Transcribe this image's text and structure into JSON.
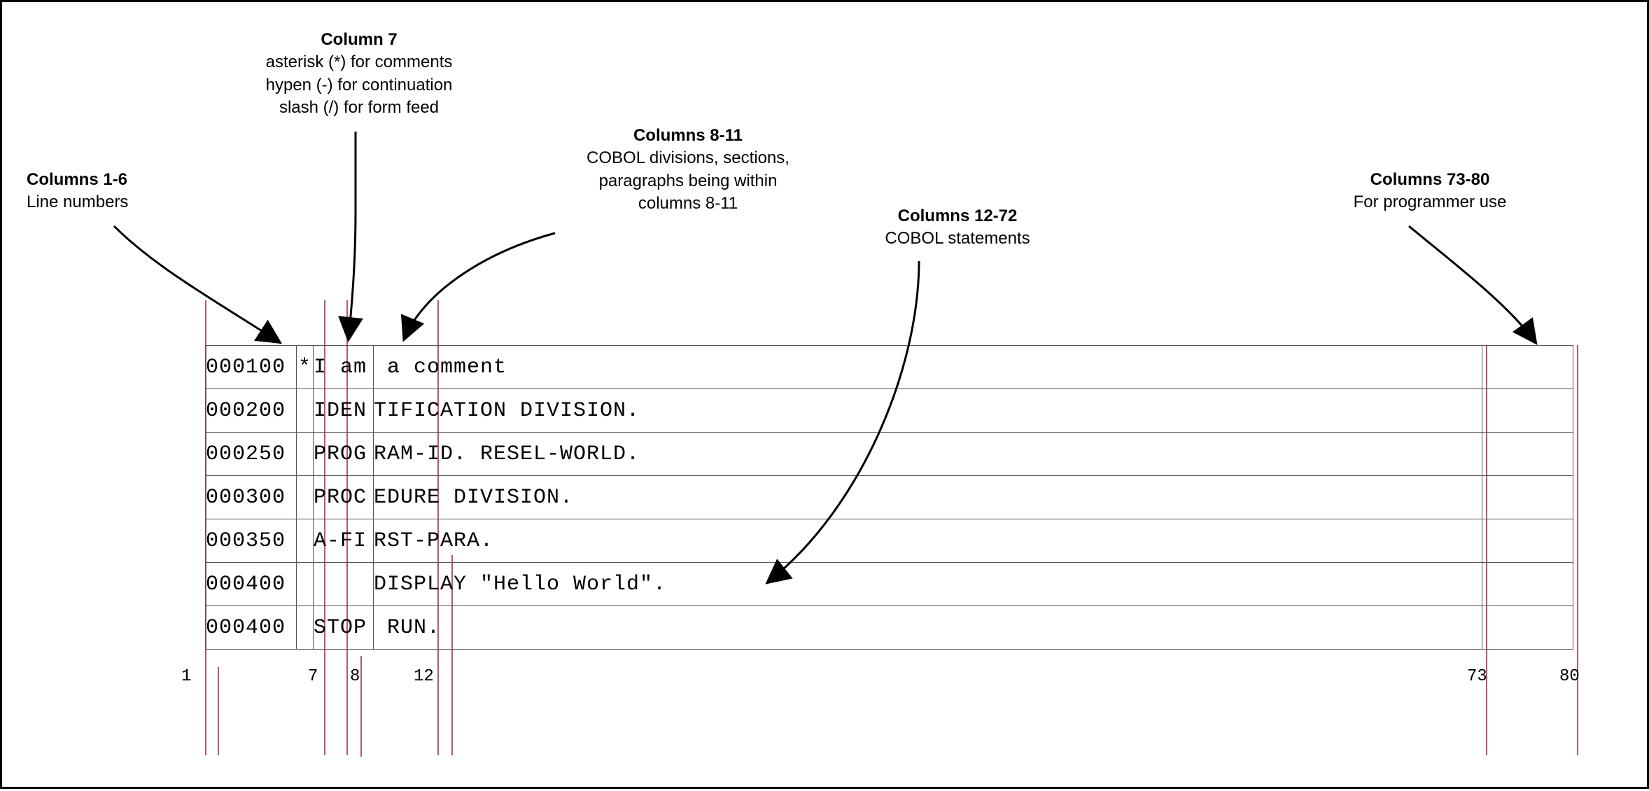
{
  "annotations": {
    "cols1_6": {
      "title": "Columns 1-6",
      "sub": "Line numbers"
    },
    "col7": {
      "title": "Column 7",
      "sub1": "asterisk (*) for comments",
      "sub2": "hypen (-) for continuation",
      "sub3": "slash (/) for form feed"
    },
    "cols8_11": {
      "title": "Columns 8-11",
      "sub1": "COBOL divisions, sections,",
      "sub2": "paragraphs being within",
      "sub3": "columns 8-11"
    },
    "cols12_72": {
      "title": "Columns 12-72",
      "sub": "COBOL statements"
    },
    "cols73_80": {
      "title": "Columns 73-80",
      "sub": "For programmer use"
    }
  },
  "rows": [
    {
      "ln": "000100",
      "ind": "*",
      "a": "I am",
      "b": " a comment"
    },
    {
      "ln": "000200",
      "ind": " ",
      "a": "IDEN",
      "b": "TIFICATION DIVISION."
    },
    {
      "ln": "000250",
      "ind": " ",
      "a": "PROG",
      "b": "RAM-ID. RESEL-WORLD."
    },
    {
      "ln": "000300",
      "ind": " ",
      "a": "PROC",
      "b": "EDURE DIVISION."
    },
    {
      "ln": "000350",
      "ind": " ",
      "a": "A-FI",
      "b": "RST-PARA."
    },
    {
      "ln": "000400",
      "ind": " ",
      "a": "    ",
      "b": "DISPLAY \"Hello World\"."
    },
    {
      "ln": "000400",
      "ind": " ",
      "a": "STOP",
      "b": " RUN."
    }
  ],
  "ruler": {
    "c1": "1",
    "c7": "7",
    "c8": "8",
    "c12": "12",
    "c73": "73",
    "c80": "80"
  }
}
